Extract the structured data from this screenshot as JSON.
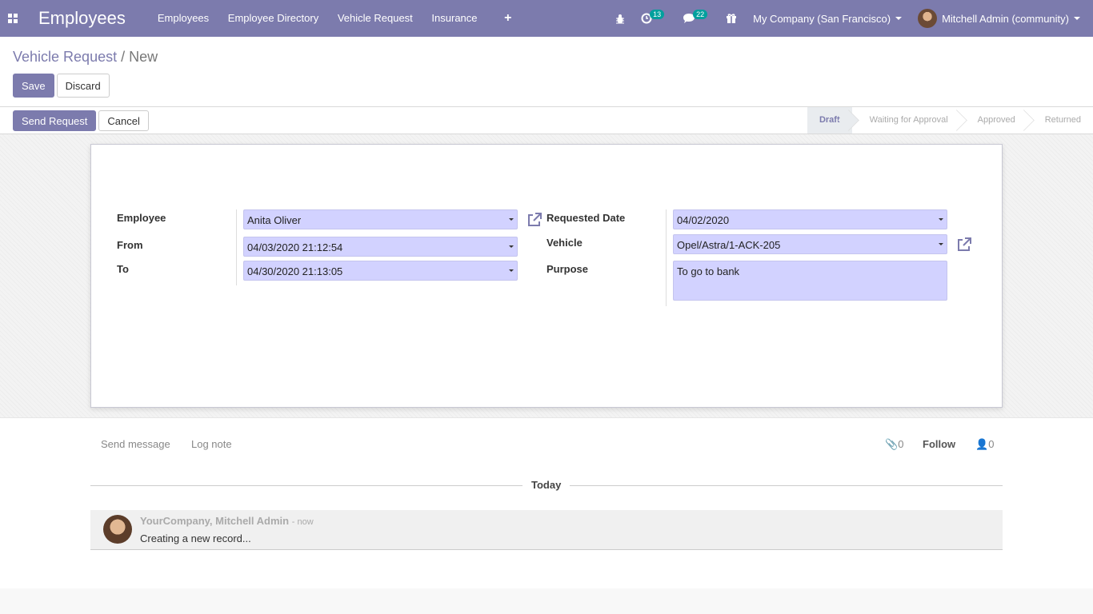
{
  "navbar": {
    "app_title": "Employees",
    "menu": [
      "Employees",
      "Employee Directory",
      "Vehicle Request",
      "Insurance"
    ],
    "add_menu_icon": "plus-icon",
    "activity_count": "13",
    "message_count": "22",
    "company": "My Company (San Francisco)",
    "user": "Mitchell Admin (community)",
    "colors": {
      "primary": "#7c7bad",
      "badge": "#00a09d"
    }
  },
  "breadcrumb": {
    "parent": "Vehicle Request",
    "separator": "/",
    "current": "New"
  },
  "buttons": {
    "save": "Save",
    "discard": "Discard",
    "send_request": "Send Request",
    "cancel": "Cancel"
  },
  "stages": [
    "Draft",
    "Waiting for Approval",
    "Approved",
    "Returned"
  ],
  "active_stage": "Draft",
  "form": {
    "employee_label": "Employee",
    "employee": "Anita Oliver",
    "from_label": "From",
    "from": "04/03/2020 21:12:54",
    "to_label": "To",
    "to": "04/30/2020 21:13:05",
    "requested_date_label": "Requested Date",
    "requested_date": "04/02/2020",
    "vehicle_label": "Vehicle",
    "vehicle": "Opel/Astra/1-ACK-205",
    "purpose_label": "Purpose",
    "purpose": "To go to bank"
  },
  "chatter": {
    "send_message": "Send message",
    "log_note": "Log note",
    "attachments": "0",
    "follow": "Follow",
    "followers": "0",
    "date_separator": "Today",
    "message": {
      "author": "YourCompany, Mitchell Admin",
      "time": "- now",
      "body": "Creating a new record..."
    }
  }
}
